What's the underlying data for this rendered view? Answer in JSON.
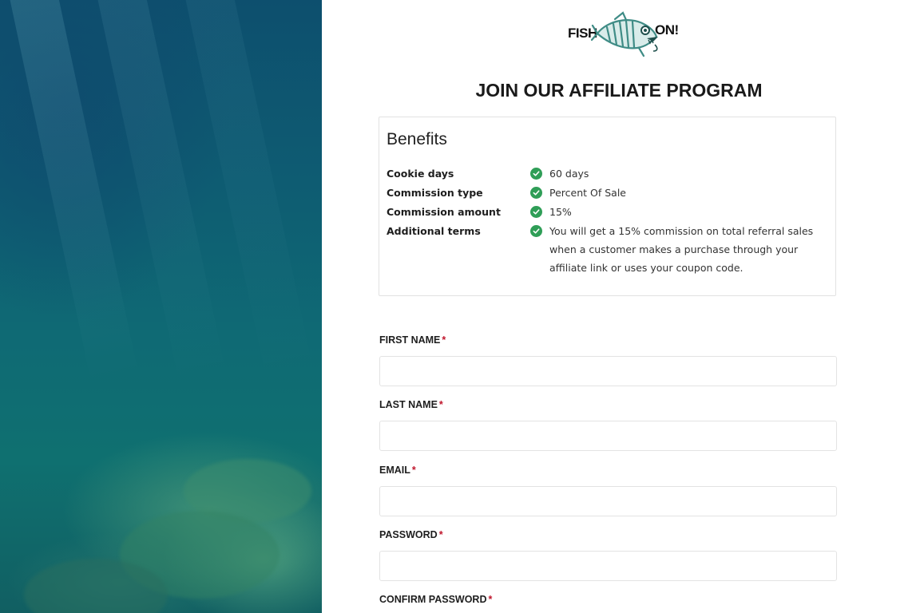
{
  "logo": {
    "left_word": "FISH",
    "right_word": "ON!"
  },
  "page_title": "JOIN OUR AFFILIATE PROGRAM",
  "benefits": {
    "heading": "Benefits",
    "rows": [
      {
        "key": "Cookie days",
        "value": "60 days"
      },
      {
        "key": "Commission type",
        "value": "Percent Of Sale"
      },
      {
        "key": "Commission amount",
        "value": "15%"
      },
      {
        "key": "Additional terms",
        "value": "You will get a 15% commission on total referral sales when a customer makes a purchase through your affiliate link or uses your coupon code."
      }
    ]
  },
  "form": {
    "required_mark": "*",
    "first_name": {
      "label": "FIRST NAME",
      "value": ""
    },
    "last_name": {
      "label": "LAST NAME",
      "value": ""
    },
    "email": {
      "label": "EMAIL",
      "value": ""
    },
    "password": {
      "label": "PASSWORD",
      "value": ""
    },
    "confirm_password": {
      "label": "CONFIRM PASSWORD",
      "value": ""
    }
  },
  "colors": {
    "check_green": "#2f9e57",
    "required_red": "#c0162c",
    "logo_teal": "#3f8c86"
  },
  "icons": {
    "logo": "fish-skeleton-icon",
    "benefit_bullet": "check-circle-icon"
  }
}
